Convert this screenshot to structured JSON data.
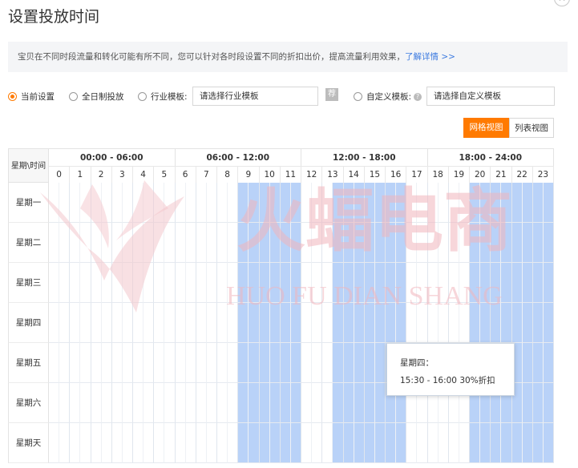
{
  "dialog": {
    "title": "设置投放时间",
    "close_label": "✕"
  },
  "notice": {
    "text": "宝贝在不同时段流量和转化可能有所不同，您可以针对各时段设置不同的折扣出价，提高流量利用效果，",
    "link": "了解详情 >>"
  },
  "options": {
    "current": "当前设置",
    "all_day": "全日制投放",
    "industry_label": "行业模板:",
    "industry_placeholder": "请选择行业模板",
    "recommend_badge": "荐",
    "custom_label": "自定义模板:",
    "custom_placeholder": "请选择自定义模板",
    "selected": "current"
  },
  "views": {
    "grid": "网格视图",
    "list": "列表视图",
    "active": "grid"
  },
  "schedule": {
    "corner": "星期\\时间",
    "ranges": [
      "00:00 - 06:00",
      "06:00 - 12:00",
      "12:00 - 18:00",
      "18:00 - 24:00"
    ],
    "hours": [
      "0",
      "1",
      "2",
      "3",
      "4",
      "5",
      "6",
      "7",
      "8",
      "9",
      "10",
      "11",
      "12",
      "13",
      "14",
      "15",
      "16",
      "17",
      "18",
      "19",
      "20",
      "21",
      "22",
      "23"
    ],
    "days": [
      "星期一",
      "星期二",
      "星期三",
      "星期四",
      "星期五",
      "星期六",
      "星期天"
    ],
    "active_half_slots": [
      18,
      19,
      20,
      21,
      22,
      23,
      27,
      28,
      29,
      30,
      31,
      32,
      33,
      40,
      41,
      42,
      43,
      44,
      45,
      46,
      47
    ]
  },
  "tooltip": {
    "day": "星期四：",
    "detail": "15:30 - 16:00  30%折扣"
  },
  "watermark": {
    "brand": "火蝠电商",
    "pinyin": "HUO FU DIAN SHANG"
  },
  "colors": {
    "accent": "#ff7a00",
    "active_cell": "#b9d2f8",
    "link": "#3d7be0"
  }
}
